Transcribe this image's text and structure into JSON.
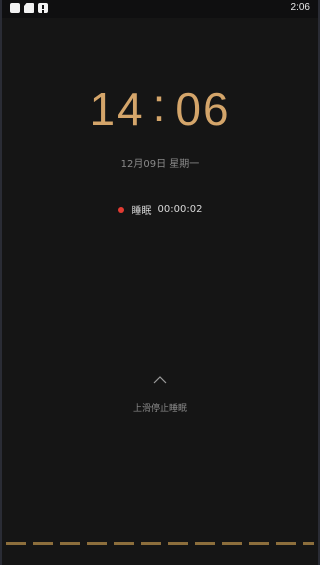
{
  "status_bar": {
    "time": "2:06",
    "icons": [
      "white-square-icon",
      "sd-card-icon",
      "alert-icon"
    ]
  },
  "clock": {
    "hour": "14",
    "separator": ":",
    "minute": "06"
  },
  "date": "12月09日 星期一",
  "recording": {
    "label": "睡眠",
    "elapsed": "00:00:02",
    "indicator_color": "#e33b32"
  },
  "swipe": {
    "icon": "chevron-up-icon",
    "label": "上滑停止睡眠"
  },
  "colors": {
    "accent": "#d4a56a",
    "background": "#151515",
    "dash": "#8c6e3c"
  }
}
